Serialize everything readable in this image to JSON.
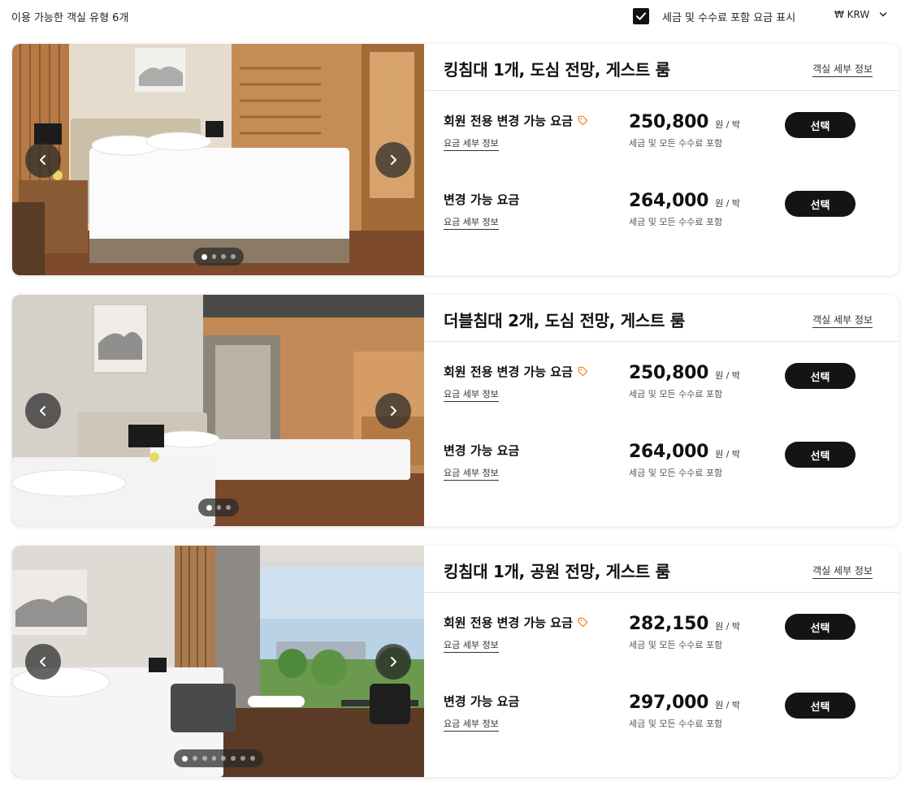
{
  "header": {
    "room_count_label": "이용 가능한 객실 유형 6개",
    "tax_toggle_label": "세금 및 수수료 포함 요금 표시",
    "tax_toggle_checked": true,
    "currency": "₩ KRW"
  },
  "rooms": [
    {
      "title": "킹침대 1개, 도심 전망, 게스트 룸",
      "detail_link": "객실 세부 정보",
      "photo_count": 4,
      "active_photo": 1,
      "rates": [
        {
          "name": "회원 전용 변경 가능 요금",
          "member_tag": true,
          "detail_link": "요금 세부 정보",
          "price": "250,800",
          "unit": "원 / 박",
          "note": "세금 및 모든 수수료 포함",
          "button": "선택"
        },
        {
          "name": "변경 가능 요금",
          "member_tag": false,
          "detail_link": "요금 세부 정보",
          "price": "264,000",
          "unit": "원 / 박",
          "note": "세금 및 모든 수수료 포함",
          "button": "선택"
        }
      ]
    },
    {
      "title": "더블침대 2개, 도심 전망, 게스트 룸",
      "detail_link": "객실 세부 정보",
      "photo_count": 3,
      "active_photo": 1,
      "rates": [
        {
          "name": "회원 전용 변경 가능 요금",
          "member_tag": true,
          "detail_link": "요금 세부 정보",
          "price": "250,800",
          "unit": "원 / 박",
          "note": "세금 및 모든 수수료 포함",
          "button": "선택"
        },
        {
          "name": "변경 가능 요금",
          "member_tag": false,
          "detail_link": "요금 세부 정보",
          "price": "264,000",
          "unit": "원 / 박",
          "note": "세금 및 모든 수수료 포함",
          "button": "선택"
        }
      ]
    },
    {
      "title": "킹침대 1개, 공원 전망, 게스트 룸",
      "detail_link": "객실 세부 정보",
      "photo_count": 8,
      "active_photo": 1,
      "rates": [
        {
          "name": "회원 전용 변경 가능 요금",
          "member_tag": true,
          "detail_link": "요금 세부 정보",
          "price": "282,150",
          "unit": "원 / 박",
          "note": "세금 및 모든 수수료 포함",
          "button": "선택"
        },
        {
          "name": "변경 가능 요금",
          "member_tag": false,
          "detail_link": "요금 세부 정보",
          "price": "297,000",
          "unit": "원 / 박",
          "note": "세금 및 모든 수수료 포함",
          "button": "선택"
        }
      ]
    }
  ],
  "colors": {
    "button_bg": "#141414",
    "tag_orange": "#f08c3a",
    "divider": "#e3e3e3"
  },
  "icons": {
    "checkbox": "checkmark-icon",
    "currency": "chevron-down-icon",
    "prev": "chevron-left-icon",
    "next": "chevron-right-icon",
    "member": "price-tag-icon"
  }
}
